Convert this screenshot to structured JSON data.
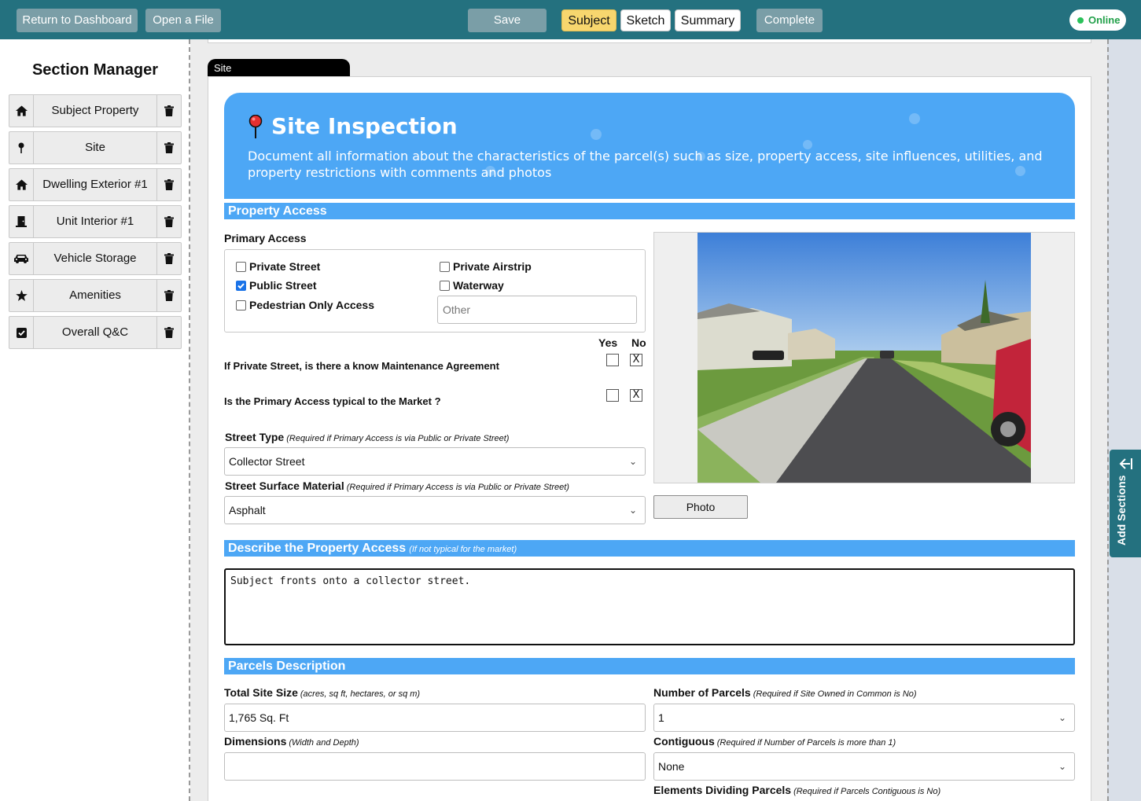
{
  "topbar": {
    "return_label": "Return to Dashboard",
    "open_label": "Open a File",
    "save_label": "Save",
    "tabs": [
      "Subject",
      "Sketch",
      "Summary"
    ],
    "active_tab": "Subject",
    "complete_label": "Complete",
    "status": "Online",
    "accent": "#24717f",
    "active_tab_color": "#f7d66e",
    "status_color": "#2bc15a"
  },
  "sidebar": {
    "title": "Section Manager",
    "items": [
      {
        "label": "Subject Property",
        "icon": "home-icon"
      },
      {
        "label": "Site",
        "icon": "map-pin-icon"
      },
      {
        "label": "Dwelling Exterior #1",
        "icon": "home-icon"
      },
      {
        "label": "Unit Interior #1",
        "icon": "door-icon"
      },
      {
        "label": "Vehicle Storage",
        "icon": "car-icon"
      },
      {
        "label": "Amenities",
        "icon": "star-icon"
      },
      {
        "label": "Overall Q&C",
        "icon": "check-square-icon"
      }
    ],
    "delete_icon": "trash-icon"
  },
  "page": {
    "tab_label": "Site",
    "hero": {
      "title": "Site Inspection",
      "description": "Document all information about the characteristics of the parcel(s) such as size, property access, site influences, utilities, and property restrictions with comments and photos",
      "color": "#4da7f5"
    },
    "property_access": {
      "heading": "Property Access",
      "primary_access_label": "Primary Access",
      "options": {
        "private_street": "Private Street",
        "public_street": "Public Street",
        "pedestrian": "Pedestrian Only Access",
        "private_airstrip": "Private Airstrip",
        "waterway": "Waterway"
      },
      "public_street_checked": true,
      "other_placeholder": "Other",
      "yes_label": "Yes",
      "no_label": "No",
      "q1": "If Private Street, is there a know Maintenance Agreement",
      "q1_no": "X",
      "q2": "Is the Primary Access typical to the Market ?",
      "q2_no": "X",
      "street_type_label": "Street Type",
      "street_type_note": "(Required if Primary Access is via Public or Private Street)",
      "street_type_value": "Collector Street",
      "surface_label": "Street Surface Material",
      "surface_note": "(Required if Primary Access is via Public or Private Street)",
      "surface_value": "Asphalt",
      "photo_label": "Photo"
    },
    "describe": {
      "heading": "Describe the Property Access",
      "note": "(If not typical for the market)",
      "text": "Subject fronts onto a collector street."
    },
    "parcels": {
      "heading": "Parcels Description",
      "total_size_label": "Total Site Size",
      "total_size_note": "(acres, sq ft, hectares, or sq m)",
      "total_size_value": "1,765 Sq. Ft",
      "num_parcels_label": "Number of Parcels",
      "num_parcels_note": "(Required if Site Owned in Common is No)",
      "num_parcels_value": "1",
      "dimensions_label": "Dimensions",
      "dimensions_note": "(Width and Depth)",
      "dimensions_value": "",
      "contiguous_label": "Contiguous",
      "contiguous_note": "(Required if Number of Parcels is more than 1)",
      "contiguous_value": "None",
      "elements_label": "Elements Dividing Parcels",
      "elements_note": "(Required if Parcels Contiguous is No)"
    }
  },
  "rail": {
    "add_sections_label": "Add Sections"
  }
}
